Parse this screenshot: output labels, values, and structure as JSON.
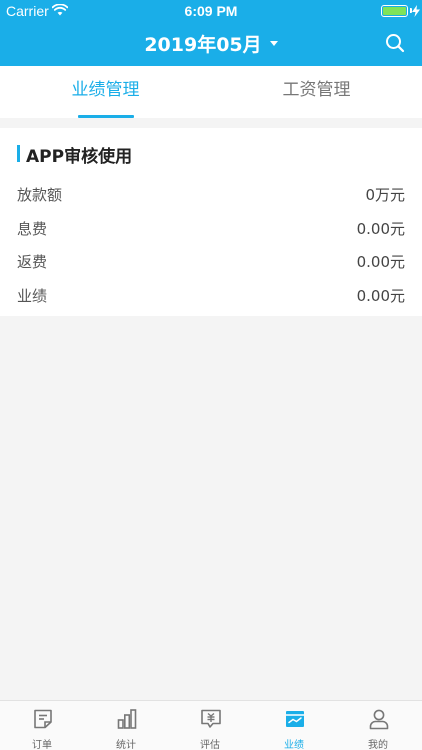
{
  "status_bar": {
    "carrier": "Carrier",
    "time": "6:09 PM"
  },
  "nav": {
    "title": "2019年05月",
    "search_icon": "search-icon"
  },
  "tabs": [
    {
      "label": "业绩管理",
      "active": true
    },
    {
      "label": "工资管理",
      "active": false
    }
  ],
  "card": {
    "title": "APP审核使用",
    "rows": [
      {
        "label": "放款额",
        "value": "0万元"
      },
      {
        "label": "息费",
        "value": "0.00元"
      },
      {
        "label": "返费",
        "value": "0.00元"
      },
      {
        "label": "业绩",
        "value": "0.00元"
      }
    ]
  },
  "tabbar": [
    {
      "label": "订单",
      "icon": "order-icon",
      "active": false
    },
    {
      "label": "统计",
      "icon": "stats-icon",
      "active": false
    },
    {
      "label": "评估",
      "icon": "evaluate-icon",
      "active": false
    },
    {
      "label": "业绩",
      "icon": "performance-icon",
      "active": true
    },
    {
      "label": "我的",
      "icon": "profile-icon",
      "active": false
    }
  ],
  "colors": {
    "accent": "#1aaee8",
    "background": "#f4f4f4",
    "battery": "#7ee35a"
  }
}
